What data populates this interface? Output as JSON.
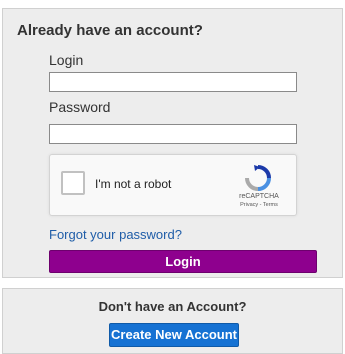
{
  "login_panel": {
    "heading": "Already have an account?",
    "login_label": "Login",
    "login_value": "",
    "password_label": "Password",
    "password_value": "",
    "captcha": {
      "checkbox_label": "I'm not a robot",
      "brand": "reCAPTCHA",
      "links": "Privacy - Terms",
      "checked": false
    },
    "forgot_link": "Forgot your password?",
    "login_button": "Login"
  },
  "signup_panel": {
    "heading": "Don't have an Account?",
    "create_button": "Create New Account"
  },
  "colors": {
    "login_button_bg": "#8e008e",
    "create_button_bg": "#1672d3",
    "link": "#1f5da8",
    "panel_bg": "#ededed"
  },
  "icons": {
    "captcha_logo": "recaptcha-logo-icon"
  }
}
